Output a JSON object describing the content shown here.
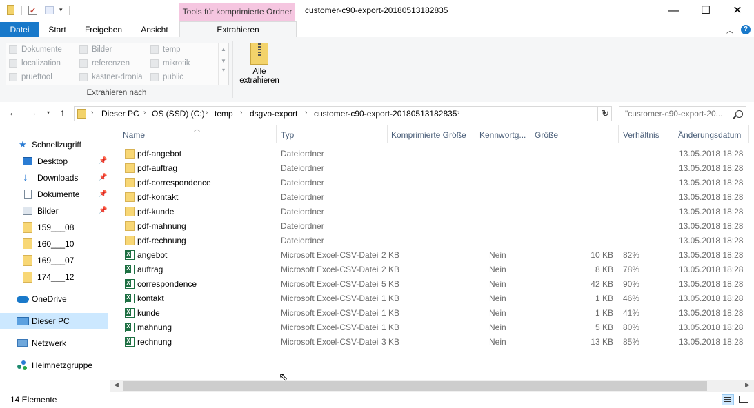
{
  "window": {
    "title": "customer-c90-export-20180513182835",
    "context_tab": "Tools für komprimierte Ordner",
    "controls": {
      "minimize": "—",
      "maximize": "☐",
      "close": "✕"
    }
  },
  "ribbon_tabs": [
    "Datei",
    "Start",
    "Freigeben",
    "Ansicht",
    "Extrahieren"
  ],
  "ribbon": {
    "destinations": [
      "Dokumente",
      "Bilder",
      "temp",
      "localization",
      "referenzen",
      "mikrotik",
      "prueftool",
      "kastner-dronia",
      "public"
    ],
    "group_label": "Extrahieren nach",
    "extract_all_line1": "Alle",
    "extract_all_line2": "extrahieren"
  },
  "address": {
    "crumbs": [
      "Dieser PC",
      "OS (SSD) (C:)",
      "temp",
      "dsgvo-export",
      "customer-c90-export-20180513182835"
    ],
    "search_placeholder": "\"customer-c90-export-20..."
  },
  "nav_pane": {
    "quick_access": "Schnellzugriff",
    "pinned": [
      "Desktop",
      "Downloads",
      "Dokumente",
      "Bilder"
    ],
    "folders": [
      "159___08",
      "160___10",
      "169___07",
      "174___12"
    ],
    "onedrive": "OneDrive",
    "this_pc": "Dieser PC",
    "network": "Netzwerk",
    "homegroup": "Heimnetzgruppe"
  },
  "columns": {
    "name": "Name",
    "type": "Typ",
    "compressed": "Komprimierte Größe",
    "password": "Kennwortg...",
    "size": "Größe",
    "ratio": "Verhältnis",
    "modified": "Änderungsdatum"
  },
  "files": [
    {
      "name": "pdf-angebot",
      "type": "Dateiordner",
      "compressed": "",
      "password": "",
      "size": "",
      "ratio": "",
      "modified": "13.05.2018 18:28",
      "icon": "folder-icon"
    },
    {
      "name": "pdf-auftrag",
      "type": "Dateiordner",
      "compressed": "",
      "password": "",
      "size": "",
      "ratio": "",
      "modified": "13.05.2018 18:28",
      "icon": "folder-icon"
    },
    {
      "name": "pdf-correspondence",
      "type": "Dateiordner",
      "compressed": "",
      "password": "",
      "size": "",
      "ratio": "",
      "modified": "13.05.2018 18:28",
      "icon": "folder-icon"
    },
    {
      "name": "pdf-kontakt",
      "type": "Dateiordner",
      "compressed": "",
      "password": "",
      "size": "",
      "ratio": "",
      "modified": "13.05.2018 18:28",
      "icon": "folder-icon"
    },
    {
      "name": "pdf-kunde",
      "type": "Dateiordner",
      "compressed": "",
      "password": "",
      "size": "",
      "ratio": "",
      "modified": "13.05.2018 18:28",
      "icon": "folder-icon"
    },
    {
      "name": "pdf-mahnung",
      "type": "Dateiordner",
      "compressed": "",
      "password": "",
      "size": "",
      "ratio": "",
      "modified": "13.05.2018 18:28",
      "icon": "folder-icon"
    },
    {
      "name": "pdf-rechnung",
      "type": "Dateiordner",
      "compressed": "",
      "password": "",
      "size": "",
      "ratio": "",
      "modified": "13.05.2018 18:28",
      "icon": "folder-icon"
    },
    {
      "name": "angebot",
      "type": "Microsoft Excel-CSV-Datei",
      "compressed": "2 KB",
      "password": "Nein",
      "size": "10 KB",
      "ratio": "82%",
      "modified": "13.05.2018 18:28",
      "icon": "excel-csv-icon"
    },
    {
      "name": "auftrag",
      "type": "Microsoft Excel-CSV-Datei",
      "compressed": "2 KB",
      "password": "Nein",
      "size": "8 KB",
      "ratio": "78%",
      "modified": "13.05.2018 18:28",
      "icon": "excel-csv-icon"
    },
    {
      "name": "correspondence",
      "type": "Microsoft Excel-CSV-Datei",
      "compressed": "5 KB",
      "password": "Nein",
      "size": "42 KB",
      "ratio": "90%",
      "modified": "13.05.2018 18:28",
      "icon": "excel-csv-icon"
    },
    {
      "name": "kontakt",
      "type": "Microsoft Excel-CSV-Datei",
      "compressed": "1 KB",
      "password": "Nein",
      "size": "1 KB",
      "ratio": "46%",
      "modified": "13.05.2018 18:28",
      "icon": "excel-csv-icon"
    },
    {
      "name": "kunde",
      "type": "Microsoft Excel-CSV-Datei",
      "compressed": "1 KB",
      "password": "Nein",
      "size": "1 KB",
      "ratio": "41%",
      "modified": "13.05.2018 18:28",
      "icon": "excel-csv-icon"
    },
    {
      "name": "mahnung",
      "type": "Microsoft Excel-CSV-Datei",
      "compressed": "1 KB",
      "password": "Nein",
      "size": "5 KB",
      "ratio": "80%",
      "modified": "13.05.2018 18:28",
      "icon": "excel-csv-icon"
    },
    {
      "name": "rechnung",
      "type": "Microsoft Excel-CSV-Datei",
      "compressed": "3 KB",
      "password": "Nein",
      "size": "13 KB",
      "ratio": "85%",
      "modified": "13.05.2018 18:28",
      "icon": "excel-csv-icon"
    }
  ],
  "status": {
    "count": "14 Elemente"
  },
  "colors": {
    "file_tab": "#1979ca",
    "context_tab": "#f5c6e0",
    "selection": "#cce8ff"
  }
}
